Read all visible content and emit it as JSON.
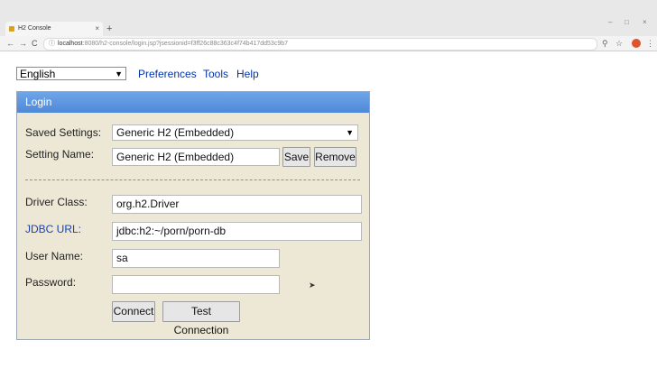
{
  "browser": {
    "tab_title": "H2 Console",
    "tab_close": "×",
    "new_tab": "+",
    "window_controls": [
      "–",
      "□",
      "×"
    ],
    "nav": {
      "back": "←",
      "forward": "→",
      "reload": "C"
    },
    "url_host": "localhost",
    "url_rest": ":8080/h2-console/login.jsp?jsessionid=f3ff26c88c363c4f74b417dd53c9b7"
  },
  "top": {
    "language": "English",
    "links": [
      "Preferences",
      "Tools",
      "Help"
    ]
  },
  "login": {
    "header": "Login",
    "saved_settings_label": "Saved Settings:",
    "saved_settings_value": "Generic H2 (Embedded)",
    "setting_name_label": "Setting Name:",
    "setting_name_value": "Generic H2 (Embedded)",
    "save_label": "Save",
    "remove_label": "Remove",
    "driver_class_label": "Driver Class:",
    "driver_class_value": "org.h2.Driver",
    "jdbc_url_label": "JDBC URL:",
    "jdbc_url_value": "jdbc:h2:~/porn/porn-db",
    "user_name_label": "User Name:",
    "user_name_value": "sa",
    "password_label": "Password:",
    "password_value": "",
    "connect_label": "Connect",
    "test_connection_label": "Test Connection"
  },
  "colors": {
    "panel_bg": "#ede8d6",
    "header_bg": "#5b93dd",
    "link": "#0033aa"
  }
}
